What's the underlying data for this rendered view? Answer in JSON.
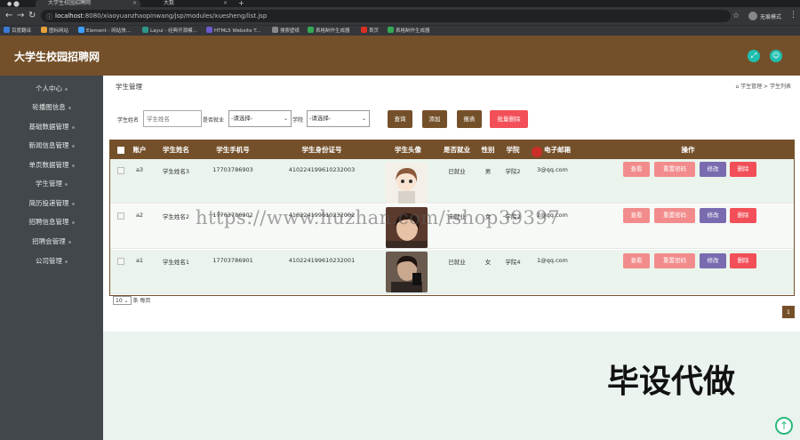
{
  "browser": {
    "tabs": [
      {
        "label": "大学生校园招聘网"
      },
      {
        "label": "大数"
      }
    ],
    "url_host": "localhost",
    "url_rest": ":8080/xiaoyuanzhaopinwang/jsp/modules/xuesheng/list.jsp",
    "incognito_label": "无痕模式",
    "bookmarks": [
      {
        "label": "百度翻译",
        "color": "#3a7bd5"
      },
      {
        "label": "图标网站",
        "color": "#e5a23a"
      },
      {
        "label": "Element - 网站快...",
        "color": "#409eff"
      },
      {
        "label": "Layui - 经典开源模...",
        "color": "#2f9688"
      },
      {
        "label": "HTML5 Website T...",
        "color": "#6a5acd"
      },
      {
        "label": "搜索壁纸",
        "color": "#888888"
      },
      {
        "label": "表格制作生成器",
        "color": "#34a853"
      },
      {
        "label": "首页",
        "color": "#d93025"
      },
      {
        "label": "表格制作生成器",
        "color": "#34a853"
      }
    ]
  },
  "header": {
    "title": "大学生校园招聘网",
    "btn_fullscreen_icon": "expand-icon",
    "btn_user_icon": "user-icon"
  },
  "sidebar": {
    "items": [
      {
        "label": "个人中心"
      },
      {
        "label": "轮播图信息"
      },
      {
        "label": "基础数据管理"
      },
      {
        "label": "新闻信息管理"
      },
      {
        "label": "单页数据管理"
      },
      {
        "label": "学生管理"
      },
      {
        "label": "简历投递管理"
      },
      {
        "label": "招聘信息管理"
      },
      {
        "label": "招聘会管理"
      },
      {
        "label": "公司管理"
      }
    ]
  },
  "page": {
    "title": "学生管理",
    "breadcrumb": "⌂ 学生管理 > 学生列表"
  },
  "filters": {
    "name_label": "学生姓名",
    "name_placeholder": "学生姓名",
    "employed_label": "是否就业",
    "employed_value": "-请选择-",
    "school_label": "学院",
    "school_value": "-请选择-",
    "search_btn": "查询",
    "add_btn": "添加",
    "report_btn": "报表",
    "batch_delete_btn": "批量删除"
  },
  "table": {
    "headers": [
      "账户",
      "学生姓名",
      "学生手机号",
      "学生身份证号",
      "学生头像",
      "是否就业",
      "性别",
      "学院",
      "电子邮箱",
      "操作"
    ],
    "rows": [
      {
        "account": "a3",
        "name": "学生姓名3",
        "phone": "17703786903",
        "id_card": "410224199610232003",
        "employed": "已就业",
        "gender": "男",
        "school": "学院2",
        "email": "3@qq.com"
      },
      {
        "account": "a2",
        "name": "学生姓名2",
        "phone": "17703786902",
        "id_card": "410224199610232002",
        "employed": "未就业",
        "gender": "女",
        "school": "学院2",
        "email": "2@qq.com"
      },
      {
        "account": "a1",
        "name": "学生姓名1",
        "phone": "17703786901",
        "id_card": "410224199610232001",
        "employed": "已就业",
        "gender": "女",
        "school": "学院4",
        "email": "1@qq.com"
      }
    ],
    "actions": {
      "view": "查看",
      "reset_pwd": "重置密码",
      "edit": "修改",
      "delete": "删除"
    }
  },
  "pager": {
    "page_size": "10",
    "page_size_suffix": "条 每页",
    "current_page": "1"
  },
  "overlay": {
    "watermark": "https://www.huzhan.com/ishop39397",
    "big_text": "毕设代做"
  }
}
